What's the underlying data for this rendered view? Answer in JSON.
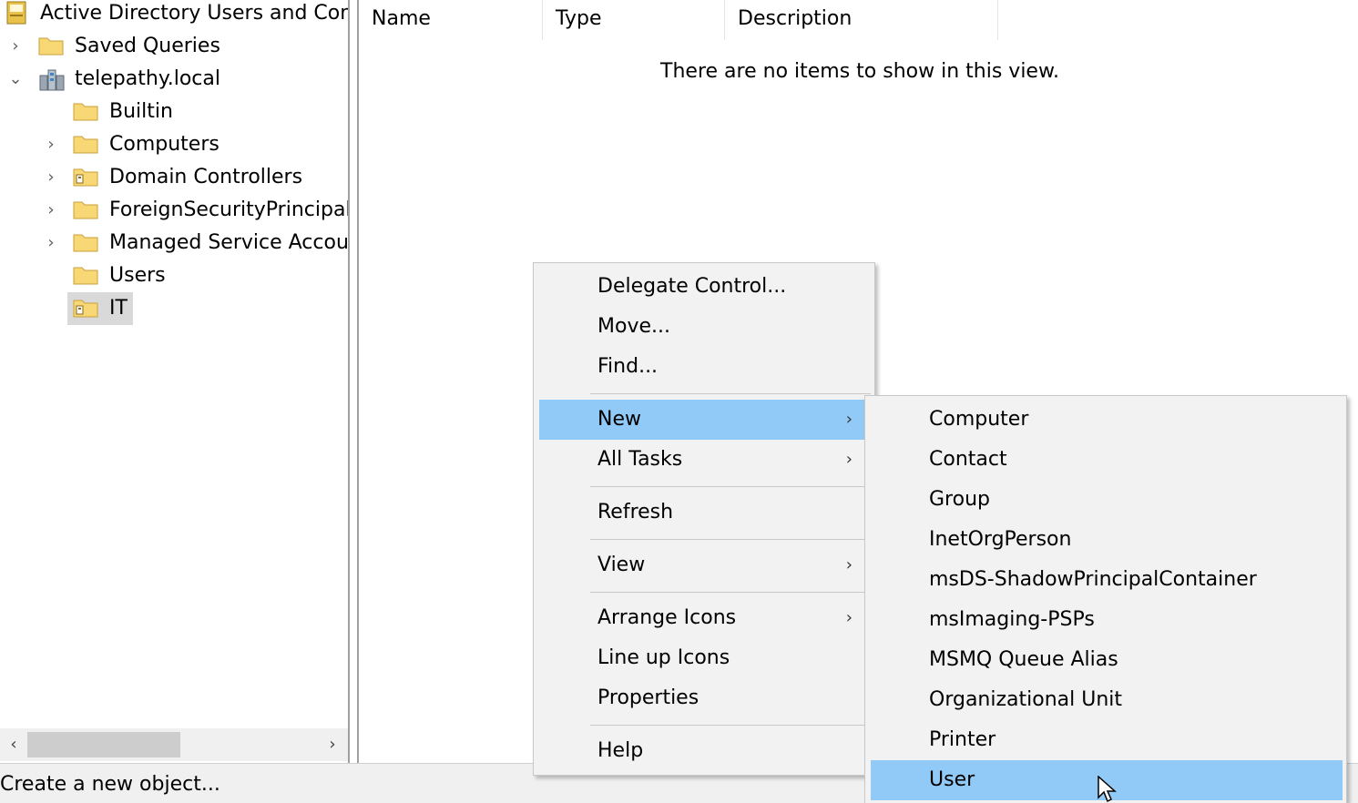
{
  "tree": {
    "root_label": "Active Directory Users and Com",
    "items": [
      {
        "label": "Saved Queries"
      },
      {
        "label": "telepathy.local"
      },
      {
        "label": "Builtin"
      },
      {
        "label": "Computers"
      },
      {
        "label": "Domain Controllers"
      },
      {
        "label": "ForeignSecurityPrincipals"
      },
      {
        "label": "Managed Service Accour"
      },
      {
        "label": "Users"
      },
      {
        "label": "IT"
      }
    ]
  },
  "list": {
    "columns": [
      "Name",
      "Type",
      "Description"
    ],
    "empty_message": "There are no items to show in this view."
  },
  "context_menu": {
    "items": [
      "Delegate Control...",
      "Move...",
      "Find...",
      "New",
      "All Tasks",
      "Refresh",
      "View",
      "Arrange Icons",
      "Line up Icons",
      "Properties",
      "Help"
    ],
    "highlighted": "New"
  },
  "submenu": {
    "items": [
      "Computer",
      "Contact",
      "Group",
      "InetOrgPerson",
      "msDS-ShadowPrincipalContainer",
      "msImaging-PSPs",
      "MSMQ Queue Alias",
      "Organizational Unit",
      "Printer",
      "User"
    ],
    "highlighted": "User"
  },
  "statusbar": {
    "text": "Create a new object..."
  },
  "colors": {
    "highlight": "#91c9f7",
    "menu_bg": "#f2f2f2",
    "folder": "#f8d775"
  }
}
